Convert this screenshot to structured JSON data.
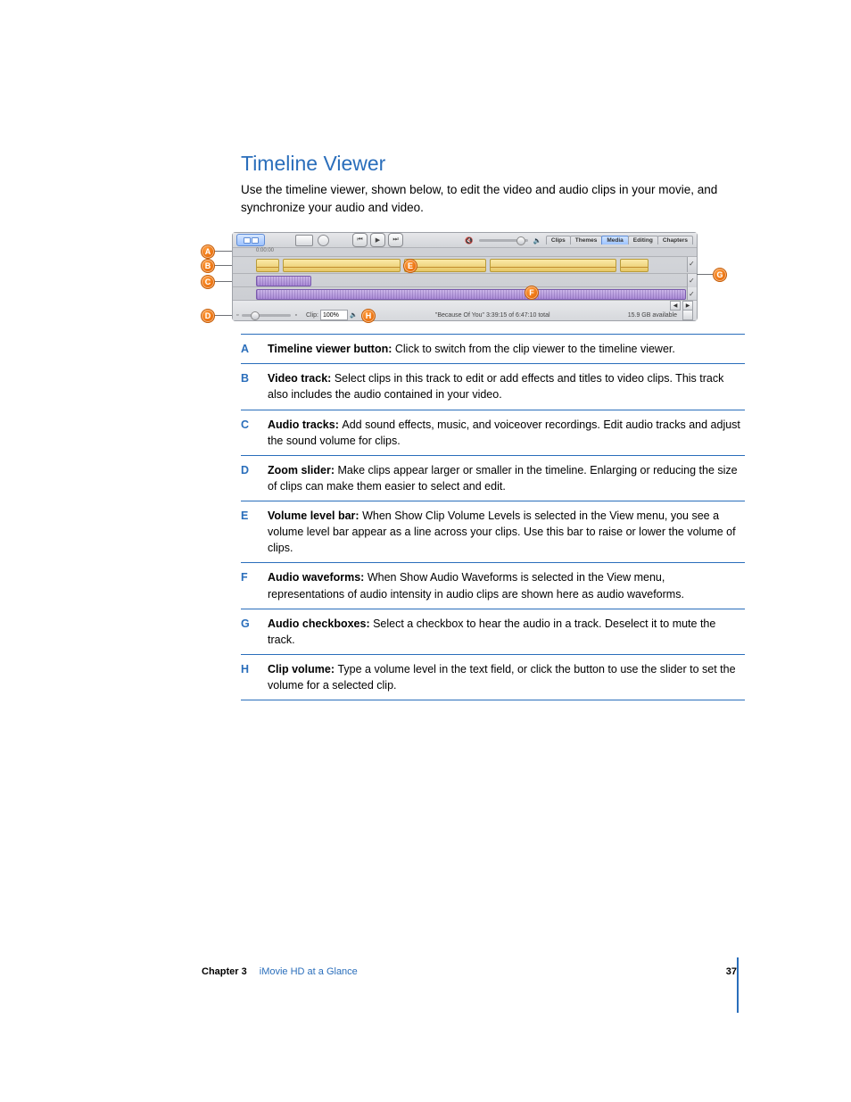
{
  "heading": "Timeline Viewer",
  "intro": "Use the timeline viewer, shown below, to edit the video and audio clips in your movie, and synchronize your audio and video.",
  "screenshot": {
    "ruler_start": "0:00:00",
    "tabs": [
      "Clips",
      "Themes",
      "Media",
      "Editing",
      "Chapters"
    ],
    "active_tab": "Media",
    "status_title": "\"Because Of You\"  3:39:15 of 6:47:10 total",
    "storage": "15.9 GB available",
    "clip_label": "Clip:",
    "clip_value": "100%",
    "speaker_glyph": "🔈",
    "speaker_mute_glyph": "🔇"
  },
  "callouts": {
    "A": "A",
    "B": "B",
    "C": "C",
    "D": "D",
    "E": "E",
    "F": "F",
    "G": "G",
    "H": "H"
  },
  "legend": [
    {
      "letter": "A",
      "term": "Timeline viewer button:",
      "text": "Click to switch from the clip viewer to the timeline viewer."
    },
    {
      "letter": "B",
      "term": "Video track:",
      "text": "Select clips in this track to edit or add effects and titles to video clips. This track also includes the audio contained in your video."
    },
    {
      "letter": "C",
      "term": "Audio tracks:",
      "text": "Add sound effects, music, and voiceover recordings. Edit audio tracks and adjust the sound volume for clips."
    },
    {
      "letter": "D",
      "term": "Zoom slider:",
      "text": "Make clips appear larger or smaller in the timeline. Enlarging or reducing the size of clips can make them easier to select and edit."
    },
    {
      "letter": "E",
      "term": "Volume level bar:",
      "text": "When Show Clip Volume Levels is selected in the View menu, you see a volume level bar appear as a line across your clips. Use this bar to raise or lower the volume of clips."
    },
    {
      "letter": "F",
      "term": "Audio waveforms:",
      "text": "When Show Audio Waveforms is selected in the View menu, representations of audio intensity in audio clips are shown here as audio waveforms."
    },
    {
      "letter": "G",
      "term": "Audio checkboxes:",
      "text": "Select a checkbox to hear the audio in a track. Deselect it to mute the track."
    },
    {
      "letter": "H",
      "term": "Clip volume:",
      "text": "Type a volume level in the text field, or click the button to use the slider to set the volume for a selected clip."
    }
  ],
  "footer": {
    "chapter": "Chapter 3",
    "chapter_name": "iMovie HD at a Glance",
    "page": "37"
  }
}
